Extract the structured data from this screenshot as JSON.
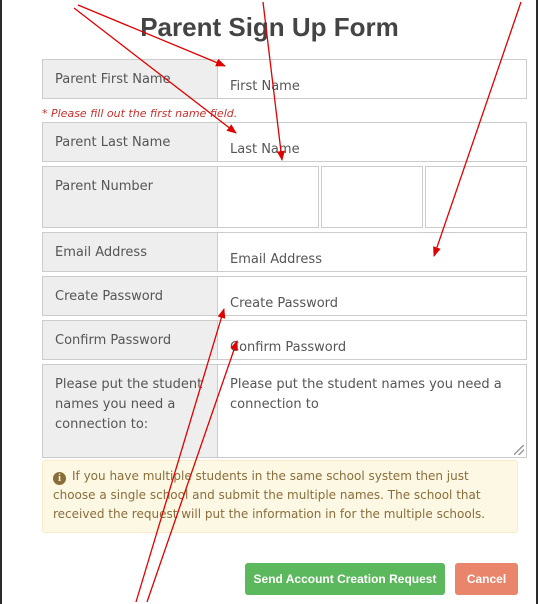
{
  "title": "Parent Sign Up Form",
  "fields": {
    "first_name": {
      "label": "Parent First Name",
      "placeholder": "First Name"
    },
    "first_name_error": "* Please fill out the first name field.",
    "last_name": {
      "label": "Parent Last Name",
      "placeholder": "Last Name"
    },
    "number": {
      "label": "Parent Number"
    },
    "email": {
      "label": "Email Address",
      "placeholder": "Email Address"
    },
    "create_password": {
      "label": "Create Password",
      "placeholder": "Create Password"
    },
    "confirm_password": {
      "label": "Confirm Password",
      "placeholder": "Confirm Password"
    },
    "students": {
      "label": "Please put the student names you need a connection to:",
      "placeholder": "Please put the student names you need a connection to"
    }
  },
  "info_icon": "info-circle-icon",
  "alert_text": "If you have multiple students in the same school system then just choose a single school and submit the multiple names. The school that received the request will put the information in for the multiple schools.",
  "buttons": {
    "send": "Send Account Creation Request",
    "cancel": "Cancel"
  },
  "colors": {
    "send": "#5cb85c",
    "cancel": "#e8856b",
    "error": "#c9302c",
    "alert_bg": "#fcf8e3",
    "annotation_arrow": "#e00000"
  }
}
